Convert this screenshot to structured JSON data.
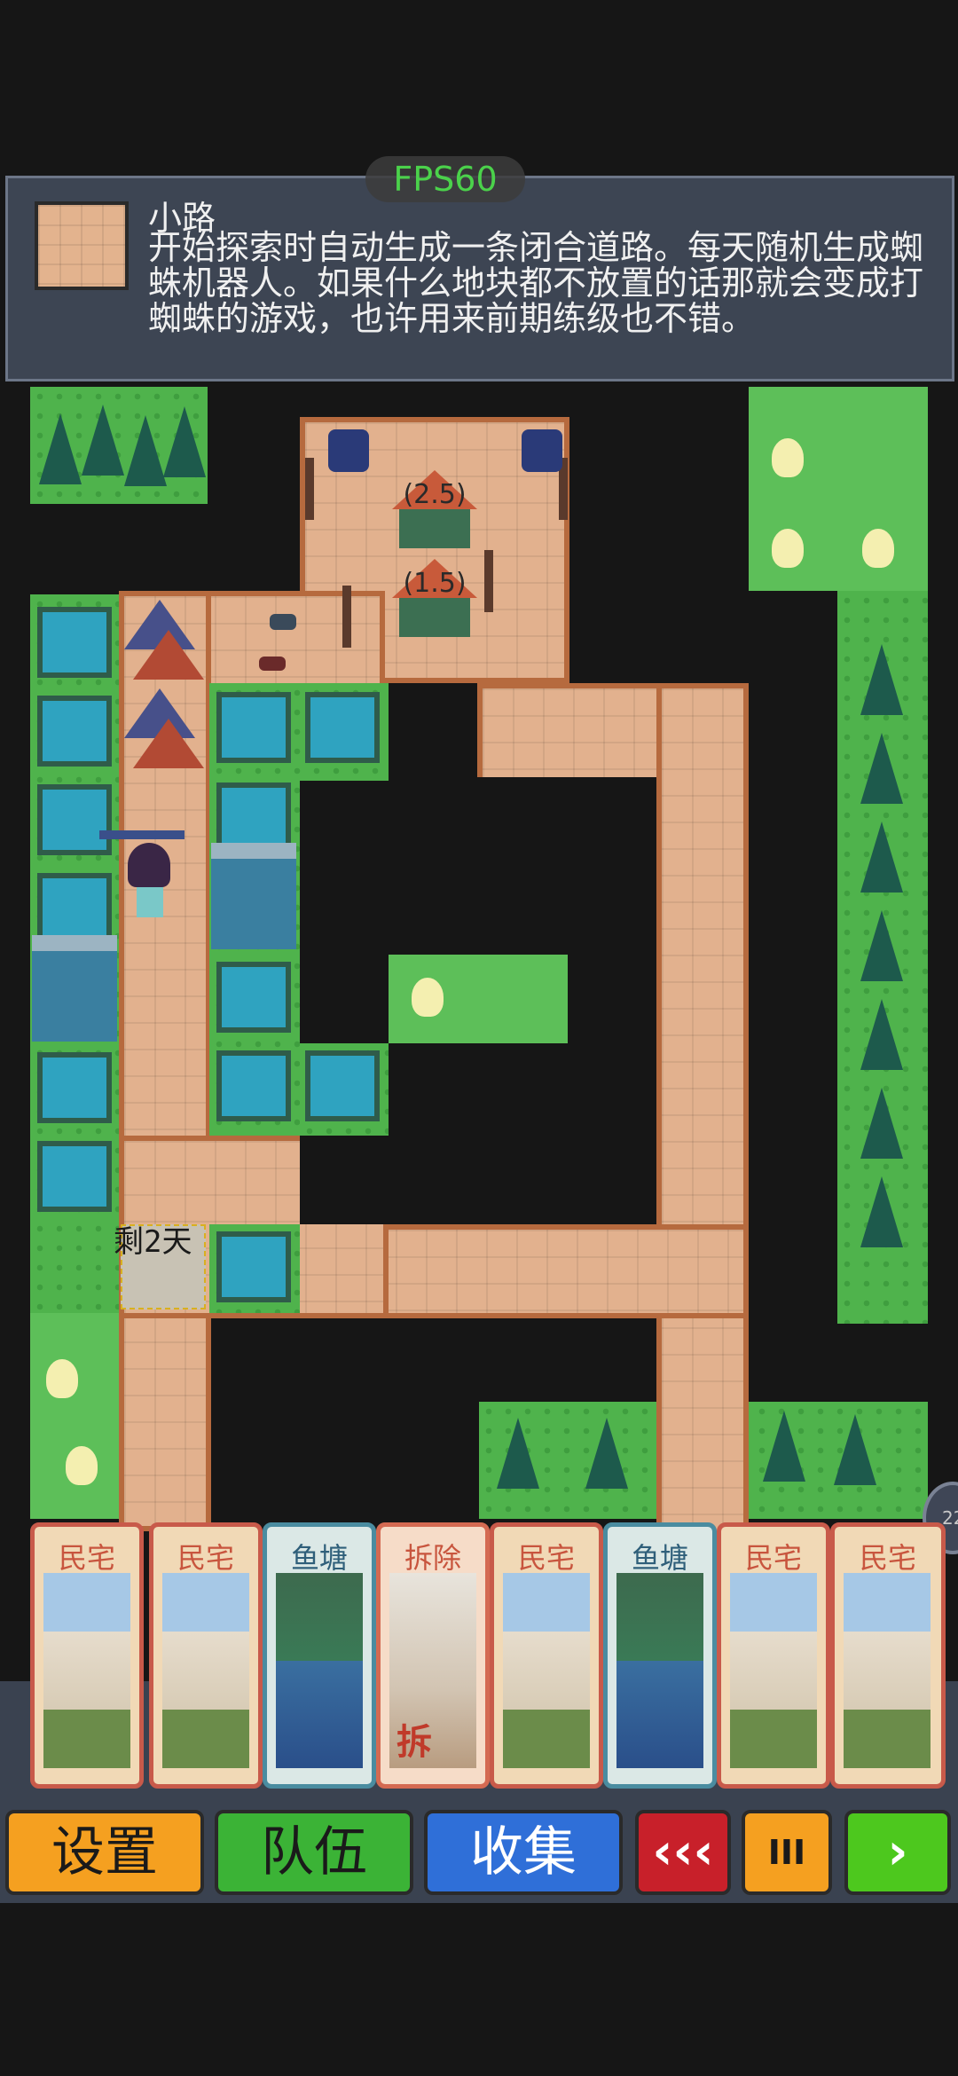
{
  "hud": {
    "fps": "FPS60",
    "side_badge": "22"
  },
  "info": {
    "title": "小路",
    "description": "开始探索时自动生成一条闭合道路。每天随机生成蜘蛛机器人。如果什么地块都不放置的话那就会变成打蜘蛛的游戏，也许用来前期练级也不错。"
  },
  "map": {
    "houses": [
      {
        "label": "(2.5)"
      },
      {
        "label": "(1.5)"
      }
    ],
    "stairs_label": "剩2天"
  },
  "cards": [
    {
      "label": "民宅",
      "kind": "house"
    },
    {
      "label": "民宅",
      "kind": "house"
    },
    {
      "label": "鱼塘",
      "kind": "pond"
    },
    {
      "label": "拆除",
      "kind": "demolish",
      "stamp": "拆"
    },
    {
      "label": "民宅",
      "kind": "house"
    },
    {
      "label": "鱼塘",
      "kind": "pond"
    },
    {
      "label": "民宅",
      "kind": "house"
    },
    {
      "label": "民宅",
      "kind": "house"
    }
  ],
  "buttons": {
    "settings": "设置",
    "team": "队伍",
    "collect": "收集",
    "rewind": "‹‹‹",
    "pause": "III",
    "next": "›"
  },
  "colors": {
    "settings": "#f5a020",
    "team": "#3bb336",
    "collect": "#2f6fd8",
    "rewind": "#c8202a",
    "pause": "#f5a020",
    "next": "#4dc81e"
  }
}
